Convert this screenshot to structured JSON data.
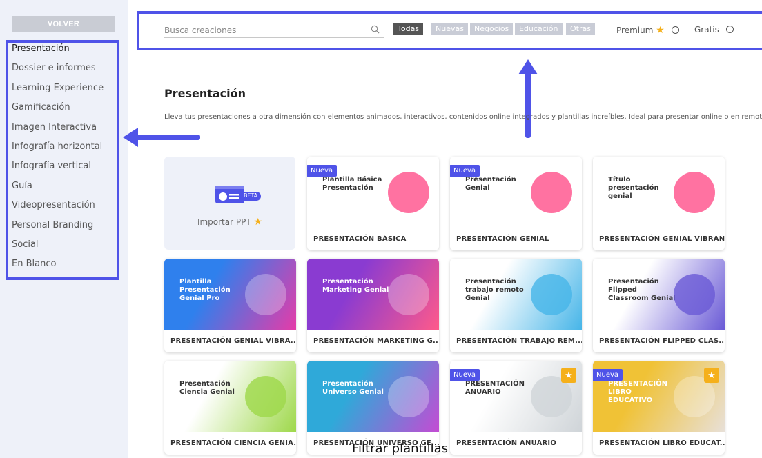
{
  "sidebar": {
    "back_label": "VOLVER",
    "items": [
      {
        "label": "Presentación",
        "active": true
      },
      {
        "label": "Dossier e informes"
      },
      {
        "label": "Learning Experience"
      },
      {
        "label": "Gamificación"
      },
      {
        "label": "Imagen Interactiva"
      },
      {
        "label": "Infografía horizontal"
      },
      {
        "label": "Infografía vertical"
      },
      {
        "label": "Guía"
      },
      {
        "label": "Videopresentación"
      },
      {
        "label": "Personal Branding"
      },
      {
        "label": "Social"
      },
      {
        "label": "En Blanco"
      }
    ]
  },
  "filters": {
    "search_placeholder": "Busca creaciones",
    "categories": [
      "Todas",
      "Nuevas",
      "Negocios",
      "Educación",
      "Otras"
    ],
    "active_category": "Todas",
    "premium_label": "Premium",
    "free_label": "Gratis"
  },
  "section": {
    "title": "Presentación",
    "description": "Lleva tus presentaciones a otra dimensión con elementos animados, interactivos, contenidos online integrados y plantillas increíbles. Ideal para presentar online o en remoto"
  },
  "import": {
    "label": "Importar PPT",
    "badge": "BETA"
  },
  "new_badge": "Nueva",
  "templates": [
    {
      "caption": "PRESENTACIÓN BÁSICA",
      "thumb_title": "Plantilla Básica Presentación",
      "new": true,
      "premium": false,
      "colors": [
        "#ffffff",
        "#ffffff"
      ]
    },
    {
      "caption": "PRESENTACIÓN GENIAL",
      "thumb_title": "Presentación Genial",
      "new": true,
      "premium": false,
      "colors": [
        "#ffffff",
        "#ffffff"
      ]
    },
    {
      "caption": "PRESENTACIÓN GENIAL VIBRANT",
      "thumb_title": "Título presentación genial",
      "new": false,
      "premium": false,
      "colors": [
        "#ffffff",
        "#ffffff"
      ]
    },
    {
      "caption": "PRESENTACIÓN GENIAL VIBRA...",
      "thumb_title": "Plantilla Presentación Genial Pro",
      "new": false,
      "premium": false,
      "colors": [
        "#2f80ed",
        "#e63ba8"
      ]
    },
    {
      "caption": "PRESENTACIÓN MARKETING G...",
      "thumb_title": "Presentación Marketing Genial",
      "new": false,
      "premium": false,
      "colors": [
        "#8a3bd1",
        "#ff5a8a"
      ]
    },
    {
      "caption": "PRESENTACIÓN TRABAJO REM...",
      "thumb_title": "Presentación trabajo remoto Genial",
      "new": false,
      "premium": false,
      "colors": [
        "#ffffff",
        "#46b5e8"
      ]
    },
    {
      "caption": "PRESENTACIÓN FLIPPED CLAS...",
      "thumb_title": "Presentación Flipped Classroom Genial",
      "new": false,
      "premium": false,
      "colors": [
        "#ffffff",
        "#6a5ad6"
      ]
    },
    {
      "caption": "PRESENTACIÓN CIENCIA GENIA...",
      "thumb_title": "Presentación Ciencia Genial",
      "new": false,
      "premium": false,
      "colors": [
        "#ffffff",
        "#9ed84a"
      ]
    },
    {
      "caption": "PRESENTACIÓN UNIVERSO GE...",
      "thumb_title": "Presentación Universo Genial",
      "new": false,
      "premium": false,
      "colors": [
        "#2fa9d9",
        "#c44bd3"
      ]
    },
    {
      "caption": "PRESENTACIÓN ANUARIO",
      "thumb_title": "PRESENTACIÓN ANUARIO",
      "new": true,
      "premium": true,
      "colors": [
        "#ffffff",
        "#cfd4d8"
      ]
    },
    {
      "caption": "PRESENTACIÓN LIBRO EDUCAT...",
      "thumb_title": "PRESENTACIÓN LIBRO EDUCATIVO",
      "new": true,
      "premium": true,
      "colors": [
        "#f0c236",
        "#e8e0d8"
      ]
    }
  ],
  "footer_caption": "Filtrar plantillas",
  "accent_color": "#4f53e8"
}
